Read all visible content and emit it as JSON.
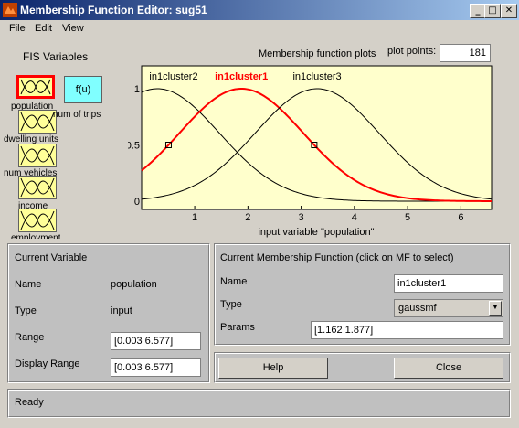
{
  "window": {
    "title": "Membership Function Editor: sug51"
  },
  "menu": [
    "File",
    "Edit",
    "View"
  ],
  "fis": {
    "title": "FIS Variables",
    "inputs": [
      "population",
      "dwelling units",
      "num vehicles",
      "income",
      "employment"
    ],
    "output": {
      "box_label": "f(u)",
      "name": "num of trips"
    }
  },
  "plot": {
    "header": "Membership function plots",
    "plot_points_label": "plot points:",
    "plot_points_value": "181",
    "xlabel": "input variable \"population\"",
    "mf_names": [
      "in1cluster2",
      "in1cluster1",
      "in1cluster3"
    ],
    "x_ticks": [
      "1",
      "2",
      "3",
      "4",
      "5",
      "6"
    ],
    "y_ticks": [
      "0",
      "0.5",
      "1"
    ]
  },
  "chart_data": {
    "type": "line",
    "xlim": [
      0.003,
      6.577
    ],
    "ylim": [
      0,
      1
    ],
    "series": [
      {
        "name": "in1cluster2",
        "sigma": 1.162,
        "center": 0.3,
        "selected": false
      },
      {
        "name": "in1cluster1",
        "sigma": 1.162,
        "center": 1.877,
        "selected": true
      },
      {
        "name": "in1cluster3",
        "sigma": 1.162,
        "center": 3.3,
        "selected": false
      }
    ],
    "colors": {
      "selected": "#ff0000",
      "normal": "#000000",
      "background": "#ffffcc"
    }
  },
  "current_variable": {
    "title": "Current Variable",
    "name_label": "Name",
    "name_value": "population",
    "type_label": "Type",
    "type_value": "input",
    "range_label": "Range",
    "range_value": "[0.003 6.577]",
    "display_range_label": "Display Range",
    "display_range_value": "[0.003 6.577]"
  },
  "current_mf": {
    "title": "Current Membership Function (click on MF to select)",
    "name_label": "Name",
    "name_value": "in1cluster1",
    "type_label": "Type",
    "type_value": "gaussmf",
    "params_label": "Params",
    "params_value": "[1.162 1.877]"
  },
  "buttons": {
    "help": "Help",
    "close": "Close"
  },
  "status": "Ready"
}
